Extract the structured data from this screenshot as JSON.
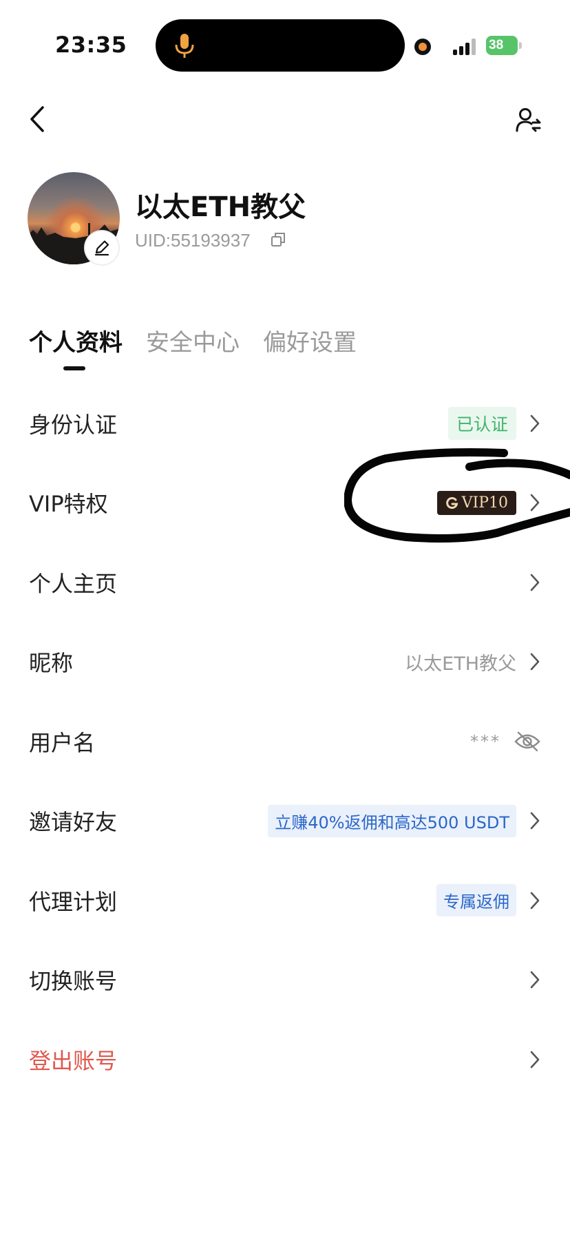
{
  "status_bar": {
    "time": "23:35",
    "battery": "38",
    "icons": [
      "microphone-icon",
      "signal-icon",
      "battery-icon"
    ]
  },
  "nav": {
    "back_icon": "chevron-left-icon",
    "switch_icon": "switch-account-icon"
  },
  "profile": {
    "name": "以太ETH教父",
    "uid": "UID:55193937",
    "icons": [
      "edit-icon",
      "copy-icon"
    ]
  },
  "tabs": [
    {
      "label": "个人资料",
      "active": true
    },
    {
      "label": "安全中心",
      "active": false
    },
    {
      "label": "偏好设置",
      "active": false
    }
  ],
  "list": {
    "identity": {
      "label": "身份认证",
      "status": "已认证"
    },
    "vip": {
      "label": "VIP特权",
      "badge": "VIP10"
    },
    "homepage": {
      "label": "个人主页"
    },
    "nickname": {
      "label": "昵称",
      "value": "以太ETH教父"
    },
    "username": {
      "label": "用户名",
      "value": "***"
    },
    "invite": {
      "label": "邀请好友",
      "promo": "立赚40%返佣和高达500 USDT"
    },
    "agent": {
      "label": "代理计划",
      "promo": "专属返佣"
    },
    "switch_account": {
      "label": "切换账号"
    },
    "logout": {
      "label": "登出账号"
    }
  },
  "colors": {
    "verified": "#3fb36d",
    "promo": "#2b66c9",
    "danger": "#e0584f",
    "vip_bg": "#2a1d18",
    "vip_text": "#f1d7b0",
    "battery": "#58c46a"
  }
}
